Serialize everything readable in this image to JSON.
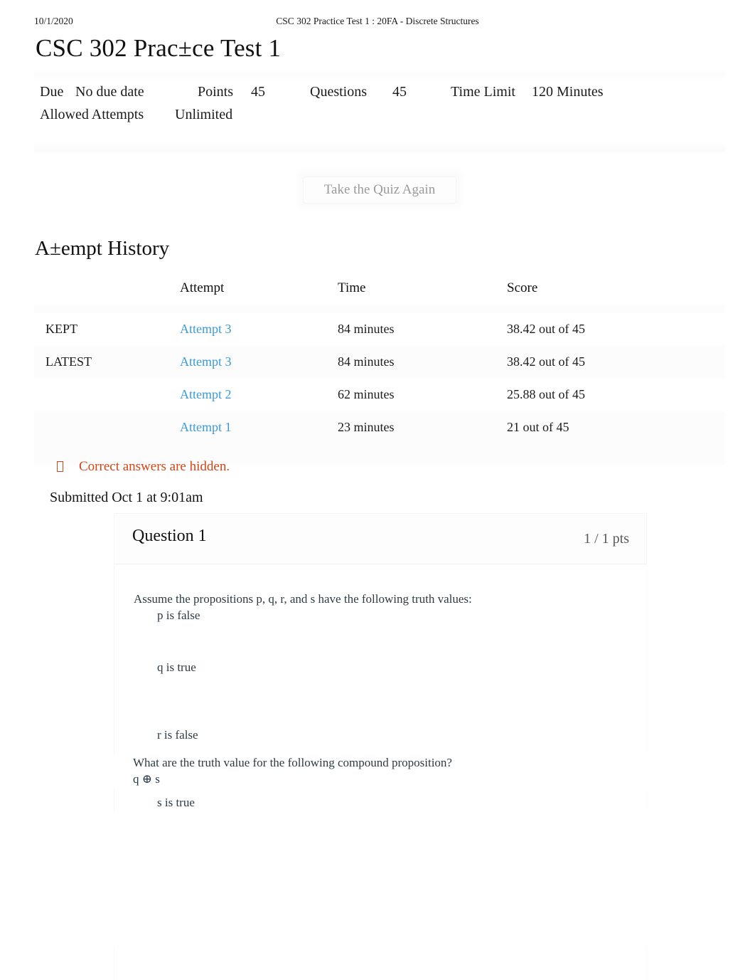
{
  "print_header": {
    "date": "10/1/2020",
    "title": "CSC 302 Practice Test 1 : 20FA - Discrete Structures"
  },
  "page_title": "CSC 302 Prac±ce Test 1",
  "quiz_info": {
    "due_label": "Due",
    "due_value": "No due date",
    "points_label": "Points",
    "points_value": "45",
    "questions_label": "Questions",
    "questions_value": "45",
    "time_limit_label": "Time Limit",
    "time_limit_value": "120 Minutes",
    "attempts_label": "Allowed Attempts",
    "attempts_value": "Unlimited"
  },
  "actions": {
    "take_again": "Take the Quiz Again"
  },
  "attempt_history": {
    "heading": "A±empt History",
    "columns": {
      "flag": "",
      "attempt": "Attempt",
      "time": "Time",
      "score": "Score"
    },
    "rows": [
      {
        "flag": "KEPT",
        "attempt": "Attempt 3",
        "time": "84 minutes",
        "score": "38.42 out of 45"
      },
      {
        "flag": "LATEST",
        "attempt": "Attempt 3",
        "time": "84 minutes",
        "score": "38.42 out of 45"
      },
      {
        "flag": "",
        "attempt": "Attempt 2",
        "time": "62 minutes",
        "score": "25.88 out of 45"
      },
      {
        "flag": "",
        "attempt": "Attempt 1",
        "time": "23 minutes",
        "score": "21 out of 45"
      }
    ]
  },
  "notice": {
    "icon": "eye-slash-icon",
    "text": "Correct answers are hidden."
  },
  "submitted": "Submitted Oct 1 at 9:01am",
  "question": {
    "title": "Question 1",
    "points": "1 / 1 pts",
    "intro": "Assume the propositions p, q, r, and s have the following truth values:",
    "values": [
      "p is false",
      "q is true",
      "r is false",
      "s is true"
    ],
    "prompt": "What are the truth value for the following compound proposition?",
    "expression": "q ⊕  s"
  },
  "colors": {
    "link": "#3b9ad9",
    "notice": "#d44516",
    "body_text": "#2d3b45",
    "heading": "#111111"
  }
}
